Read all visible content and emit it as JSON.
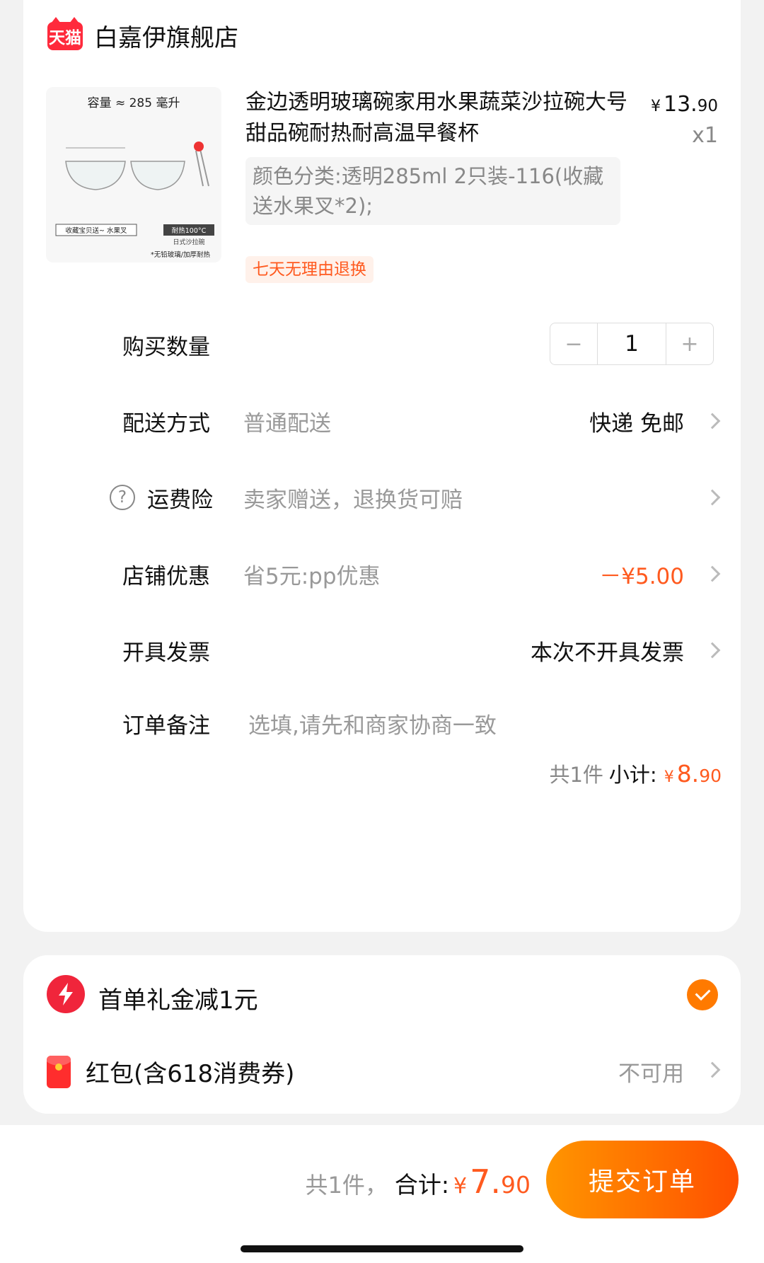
{
  "shop": {
    "badge": "天猫",
    "name": "白嘉伊旗舰店"
  },
  "product": {
    "image_caption": "容量 ≈ 285 毫升",
    "image_label_left": "收藏宝贝送~ 水果叉",
    "image_label_right": "耐热100°C",
    "image_label_right_sub": "日式沙拉碗",
    "image_note": "*无铅玻璃/加厚耐热",
    "title": "金边透明玻璃碗家用水果蔬菜沙拉碗大号甜品碗耐热耐高温早餐杯",
    "price_symbol": "¥",
    "price_int": "13.",
    "price_dec": "90",
    "quantity_mark": "x1",
    "variant": "颜色分类:透明285ml 2只装-116(收藏送水果叉*2);",
    "return_tag": "七天无理由退换"
  },
  "rows": {
    "quantity": {
      "label": "购买数量",
      "minus": "−",
      "value": "1",
      "plus": "+"
    },
    "delivery": {
      "label": "配送方式",
      "sub": "普通配送",
      "value": "快递 免邮"
    },
    "insurance": {
      "label": "运费险",
      "sub": "卖家赠送，退换货可赔",
      "icon": "?"
    },
    "discount": {
      "label": "店铺优惠",
      "sub": "省5元:pp优惠",
      "value": "－¥5.00"
    },
    "invoice": {
      "label": "开具发票",
      "value": "本次不开具发票"
    },
    "note": {
      "label": "订单备注",
      "placeholder": "选填,请先和商家协商一致"
    }
  },
  "subtotal": {
    "count_text": "共1件",
    "label": "小计:",
    "symbol": "¥",
    "amount_int": "8.",
    "amount_dec": "90"
  },
  "promo": {
    "first_order": "首单礼金减1元",
    "red_packet": "红包(含618消费券)",
    "red_packet_status": "不可用"
  },
  "footer": {
    "count_text": "共1件，",
    "label": "合计:",
    "symbol": "¥",
    "amount_int": "7.",
    "amount_dec": "90",
    "submit": "提交订单"
  },
  "colors": {
    "accent": "#ff5a1f",
    "tmall_red": "#ff2a3c",
    "check_orange": "#ff7a00"
  }
}
